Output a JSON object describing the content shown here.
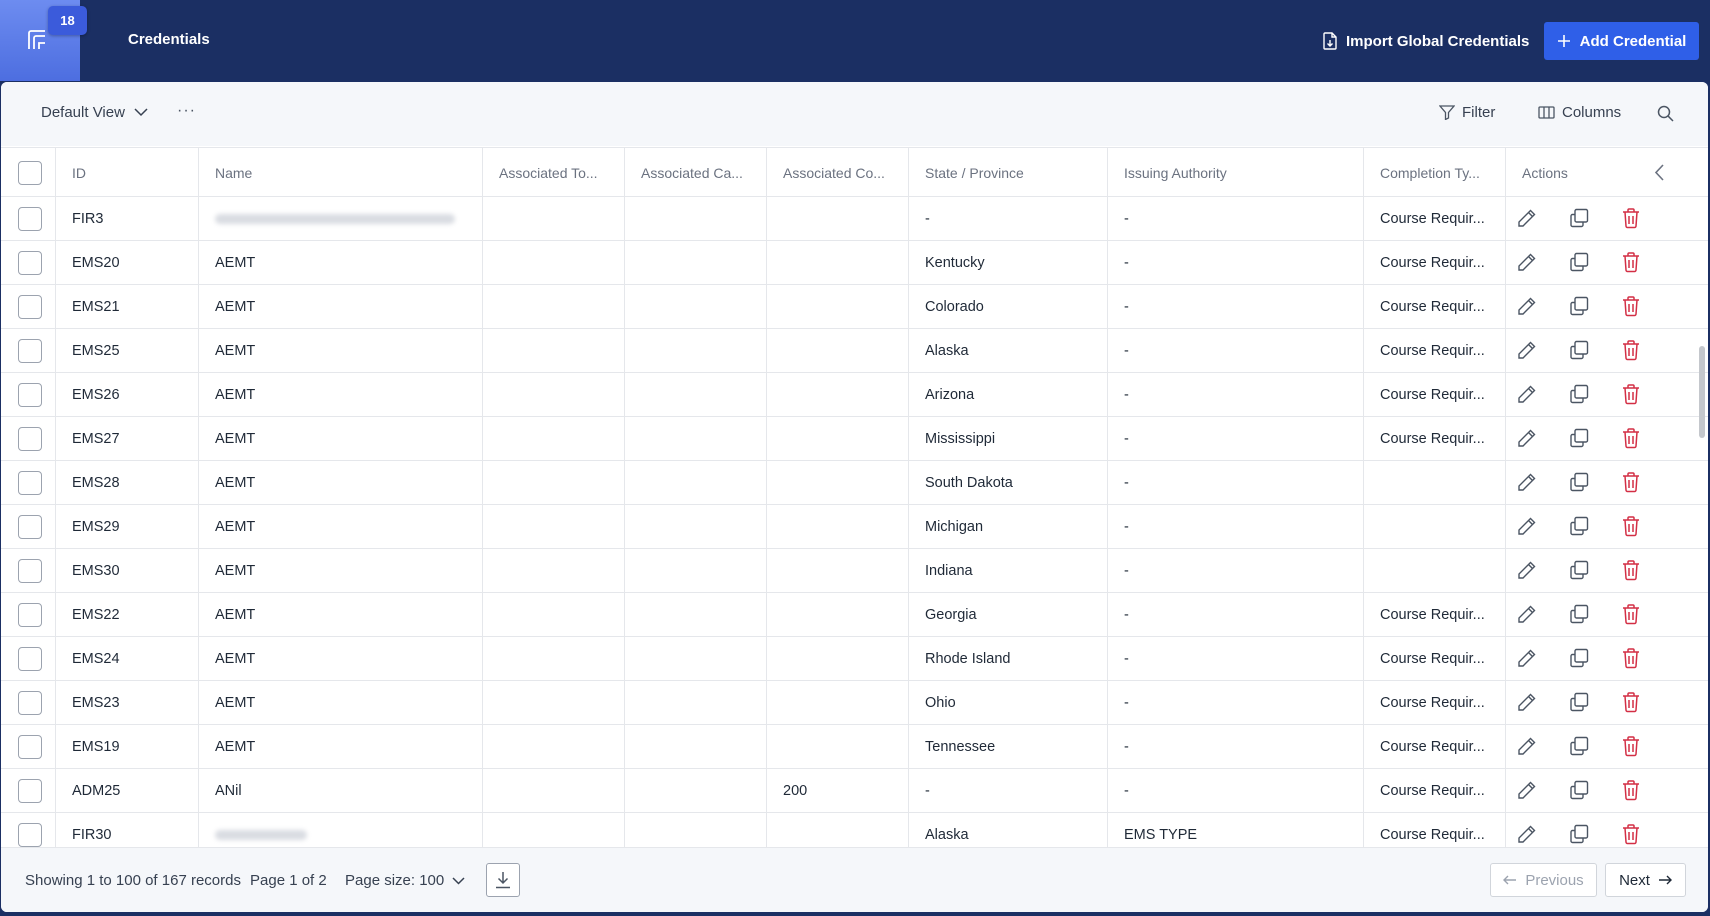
{
  "header": {
    "badge_count": "18",
    "title": "Credentials",
    "import_label": "Import Global Credentials",
    "add_label": "Add Credential"
  },
  "toolbar": {
    "view_label": "Default View",
    "more_label": "···",
    "filter_label": "Filter",
    "columns_label": "Columns"
  },
  "table": {
    "columns": [
      "ID",
      "Name",
      "Associated To...",
      "Associated Ca...",
      "Associated Co...",
      "State / Province",
      "Issuing Authority",
      "Completion Ty...",
      "Actions"
    ],
    "rows": [
      {
        "id": "FIR3",
        "name": "",
        "name_blurred": true,
        "assoc_to": "",
        "assoc_ca": "",
        "assoc_co": "",
        "state": "-",
        "authority": "-",
        "completion": "Course Requir..."
      },
      {
        "id": "EMS20",
        "name": "AEMT",
        "assoc_to": "",
        "assoc_ca": "",
        "assoc_co": "",
        "state": "Kentucky",
        "authority": "-",
        "completion": "Course Requir..."
      },
      {
        "id": "EMS21",
        "name": "AEMT",
        "assoc_to": "",
        "assoc_ca": "",
        "assoc_co": "",
        "state": "Colorado",
        "authority": "-",
        "completion": "Course Requir..."
      },
      {
        "id": "EMS25",
        "name": "AEMT",
        "assoc_to": "",
        "assoc_ca": "",
        "assoc_co": "",
        "state": "Alaska",
        "authority": "-",
        "completion": "Course Requir..."
      },
      {
        "id": "EMS26",
        "name": "AEMT",
        "assoc_to": "",
        "assoc_ca": "",
        "assoc_co": "",
        "state": "Arizona",
        "authority": "-",
        "completion": "Course Requir..."
      },
      {
        "id": "EMS27",
        "name": "AEMT",
        "assoc_to": "",
        "assoc_ca": "",
        "assoc_co": "",
        "state": "Mississippi",
        "authority": "-",
        "completion": "Course Requir..."
      },
      {
        "id": "EMS28",
        "name": "AEMT",
        "assoc_to": "",
        "assoc_ca": "",
        "assoc_co": "",
        "state": "South Dakota",
        "authority": "-",
        "completion": ""
      },
      {
        "id": "EMS29",
        "name": "AEMT",
        "assoc_to": "",
        "assoc_ca": "",
        "assoc_co": "",
        "state": "Michigan",
        "authority": "-",
        "completion": ""
      },
      {
        "id": "EMS30",
        "name": "AEMT",
        "assoc_to": "",
        "assoc_ca": "",
        "assoc_co": "",
        "state": "Indiana",
        "authority": "-",
        "completion": ""
      },
      {
        "id": "EMS22",
        "name": "AEMT",
        "assoc_to": "",
        "assoc_ca": "",
        "assoc_co": "",
        "state": "Georgia",
        "authority": "-",
        "completion": "Course Requir..."
      },
      {
        "id": "EMS24",
        "name": "AEMT",
        "assoc_to": "",
        "assoc_ca": "",
        "assoc_co": "",
        "state": "Rhode Island",
        "authority": "-",
        "completion": "Course Requir..."
      },
      {
        "id": "EMS23",
        "name": "AEMT",
        "assoc_to": "",
        "assoc_ca": "",
        "assoc_co": "",
        "state": "Ohio",
        "authority": "-",
        "completion": "Course Requir..."
      },
      {
        "id": "EMS19",
        "name": "AEMT",
        "assoc_to": "",
        "assoc_ca": "",
        "assoc_co": "",
        "state": "Tennessee",
        "authority": "-",
        "completion": "Course Requir..."
      },
      {
        "id": "ADM25",
        "name": "ANil",
        "assoc_to": "",
        "assoc_ca": "",
        "assoc_co": "200",
        "state": "-",
        "authority": "-",
        "completion": "Course Requir..."
      },
      {
        "id": "FIR30",
        "name": "",
        "name_blurred": true,
        "assoc_to": "",
        "assoc_ca": "",
        "assoc_co": "",
        "state": "Alaska",
        "authority": "EMS TYPE",
        "completion": "Course Requir..."
      }
    ]
  },
  "footer": {
    "records_text": "Showing 1 to 100 of 167 records",
    "page_text": "Page 1 of 2",
    "page_size_text": "Page size: 100",
    "prev_label": "Previous",
    "next_label": "Next"
  },
  "colors": {
    "topbar": "#1b2f63",
    "accent": "#2f5fe8",
    "delete": "#d32f45"
  },
  "icons": [
    "logo-icon",
    "import-icon",
    "plus-icon",
    "chevron-down-icon",
    "filter-icon",
    "columns-icon",
    "search-icon",
    "collapse-icon",
    "edit-icon",
    "copy-icon",
    "trash-icon",
    "download-icon",
    "arrow-left-icon",
    "arrow-right-icon"
  ]
}
